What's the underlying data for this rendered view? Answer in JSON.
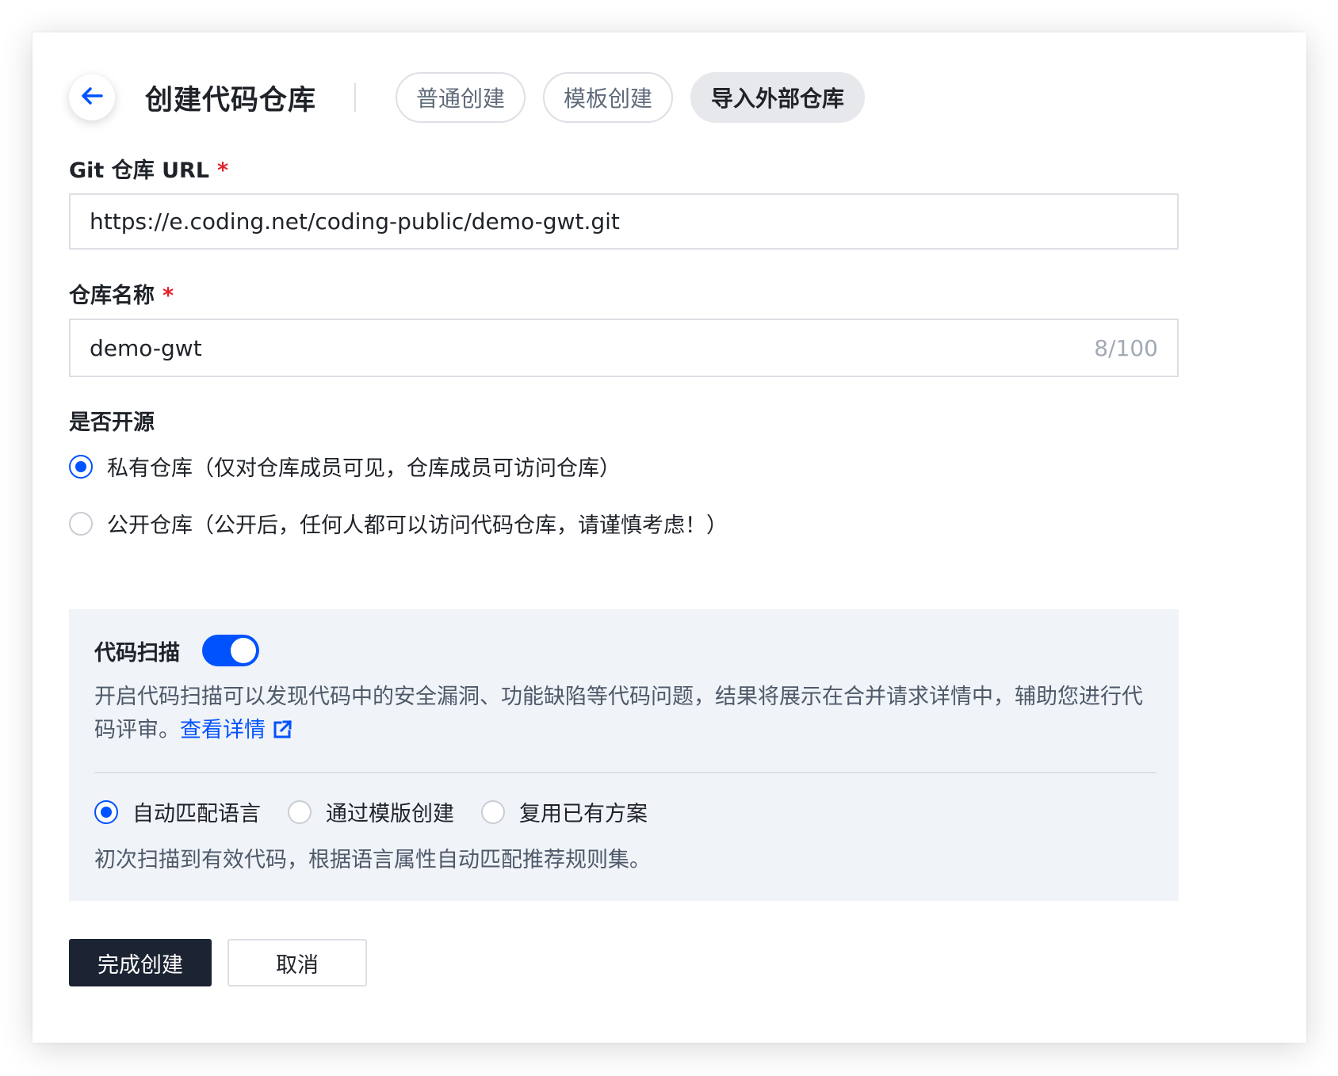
{
  "header": {
    "title": "创建代码仓库",
    "tabs": [
      {
        "label": "普通创建",
        "active": false
      },
      {
        "label": "模板创建",
        "active": false
      },
      {
        "label": "导入外部仓库",
        "active": true
      }
    ]
  },
  "form": {
    "git_url": {
      "label": "Git 仓库 URL",
      "required_mark": "*",
      "value": "https://e.coding.net/coding-public/demo-gwt.git"
    },
    "repo_name": {
      "label": "仓库名称",
      "required_mark": "*",
      "value": "demo-gwt",
      "counter": "8/100"
    },
    "open_source": {
      "label": "是否开源",
      "options": [
        {
          "label": "私有仓库（仅对仓库成员可见，仓库成员可访问仓库）",
          "checked": true
        },
        {
          "label": "公开仓库（公开后，任何人都可以访问代码仓库，请谨慎考虑！）",
          "checked": false
        }
      ]
    }
  },
  "code_scan": {
    "title": "代码扫描",
    "enabled": true,
    "description": "开启代码扫描可以发现代码中的安全漏洞、功能缺陷等代码问题，结果将展示在合并请求详情中，辅助您进行代码评审。",
    "link_label": "查看详情",
    "options": [
      {
        "label": "自动匹配语言",
        "checked": true
      },
      {
        "label": "通过模版创建",
        "checked": false
      },
      {
        "label": "复用已有方案",
        "checked": false
      }
    ],
    "note": "初次扫描到有效代码，根据语言属性自动匹配推荐规则集。"
  },
  "actions": {
    "submit_label": "完成创建",
    "cancel_label": "取消"
  },
  "colors": {
    "accent": "#0052ff",
    "required": "#e5212b",
    "primary_button": "#1c2333",
    "panel_bg": "#f0f3f8"
  },
  "icons": {
    "back": "arrow-left-icon",
    "external_link": "external-link-icon"
  }
}
